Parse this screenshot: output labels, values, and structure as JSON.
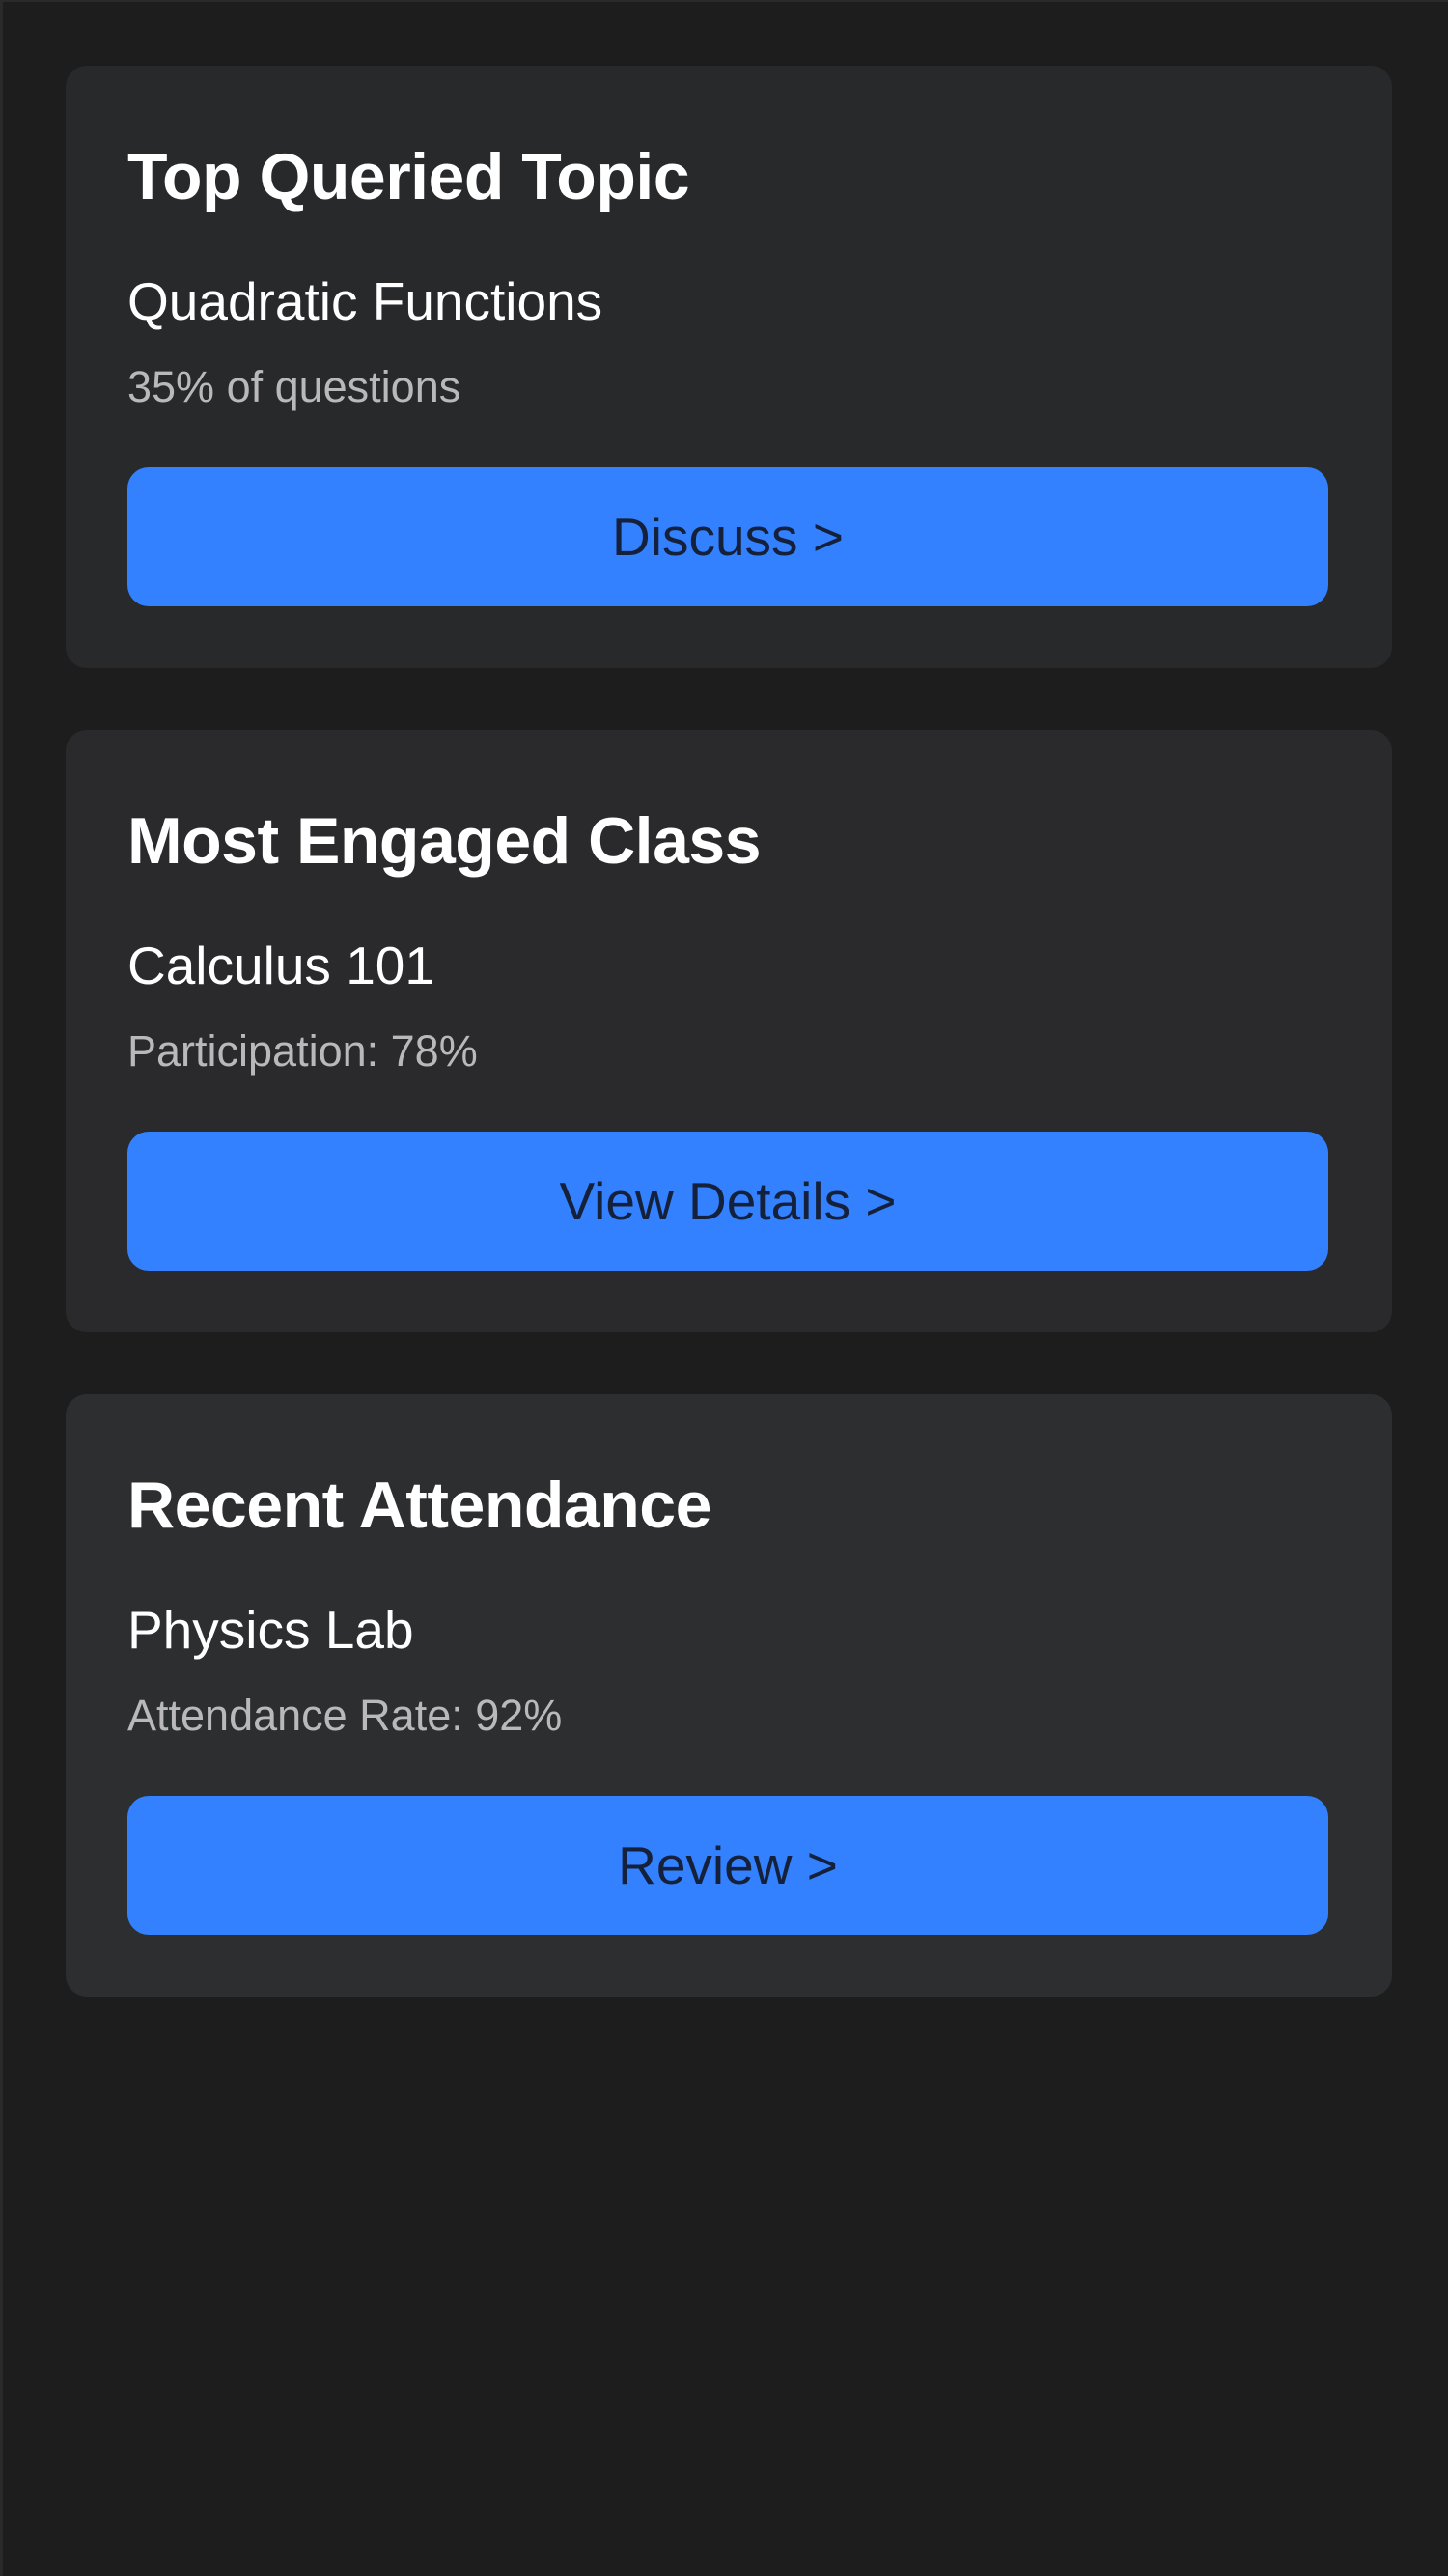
{
  "cards": [
    {
      "title": "Top Queried Topic",
      "subject": "Quadratic Functions",
      "stat": "35% of questions",
      "button_label": "Discuss >"
    },
    {
      "title": "Most Engaged Class",
      "subject": "Calculus 101",
      "stat": "Participation: 78%",
      "button_label": "View Details >"
    },
    {
      "title": "Recent Attendance",
      "subject": "Physics Lab",
      "stat": "Attendance Rate: 92%",
      "button_label": "Review >"
    }
  ],
  "colors": {
    "background": "#1d1d1d",
    "card": "#2a2a2c",
    "accent_button": "#3381fe",
    "button_text": "#15213a",
    "title_text": "#ffffff",
    "secondary_text": "#b9b9bb"
  }
}
